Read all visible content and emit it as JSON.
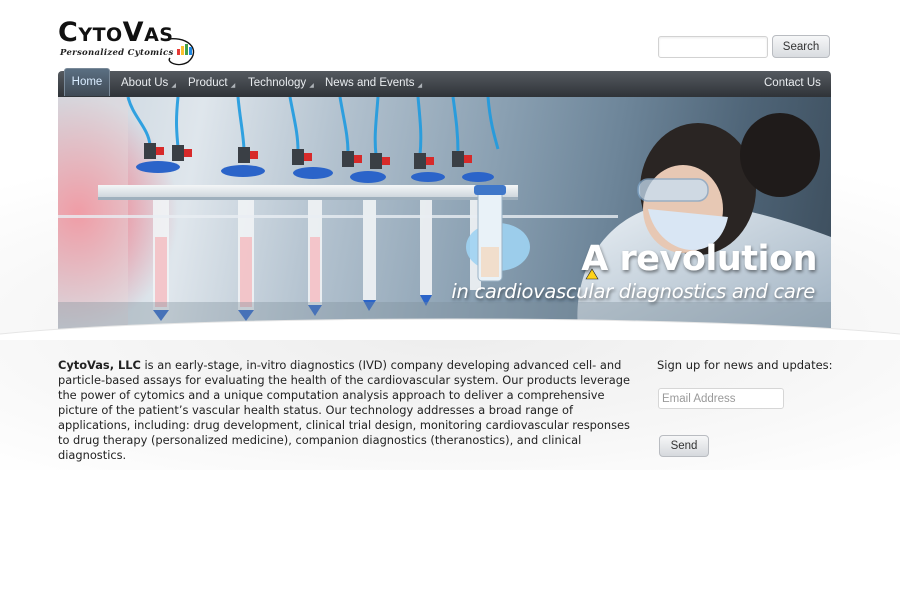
{
  "header": {
    "logo_text": "CytoVas",
    "logo_tagline": "Personalized Cytomics",
    "search_button": "Search",
    "search_placeholder": ""
  },
  "nav": {
    "home": "Home",
    "items": [
      {
        "label": "About Us",
        "has_dropdown": true
      },
      {
        "label": "Product",
        "has_dropdown": true
      },
      {
        "label": "Technology",
        "has_dropdown": true
      },
      {
        "label": "News and Events",
        "has_dropdown": true
      }
    ],
    "contact": "Contact Us"
  },
  "hero": {
    "title": "A revolution",
    "subtitle": "in cardiovascular diagnostics and care"
  },
  "about": {
    "company": "CytoVas, LLC",
    "text": " is an early-stage, in-vitro diagnostics (IVD) company developing advanced cell- and particle-based assays for evaluating the health of the cardiovascular system. Our products leverage the power of cytomics and a unique computation analysis approach to deliver a comprehensive picture of the patient’s vascular health status. Our technology addresses a broad range of applications, including: drug development, clinical trial design, monitoring cardiovascular responses to drug therapy (personalized medicine), companion diagnostics (theranostics), and clinical diagnostics."
  },
  "signup": {
    "label": "Sign up for news and updates:",
    "email_placeholder": "Email Address",
    "send_button": "Send"
  },
  "colors": {
    "nav_dark": "#2f3338",
    "nav_light": "#555a60",
    "home_tab": "#4e5f70",
    "text": "#222222"
  }
}
